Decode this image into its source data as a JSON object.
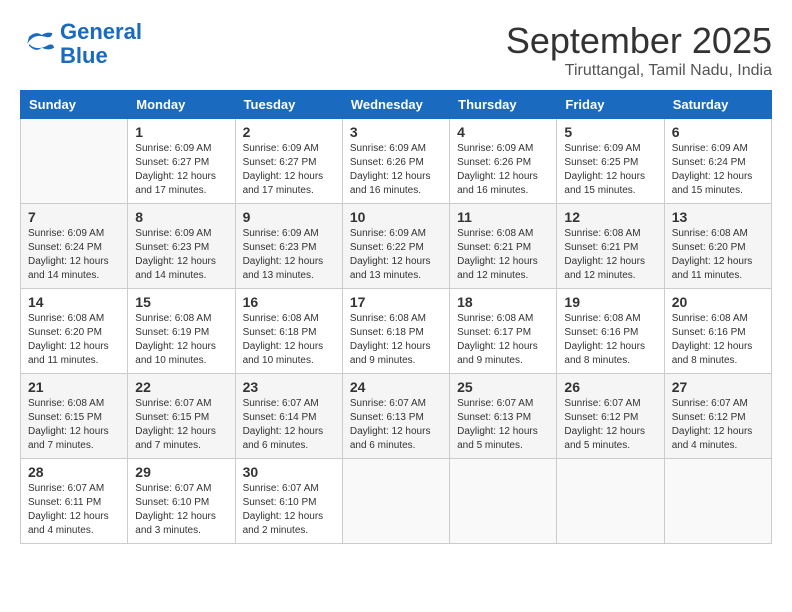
{
  "logo": {
    "line1": "General",
    "line2": "Blue"
  },
  "title": "September 2025",
  "location": "Tiruttangal, Tamil Nadu, India",
  "days_of_week": [
    "Sunday",
    "Monday",
    "Tuesday",
    "Wednesday",
    "Thursday",
    "Friday",
    "Saturday"
  ],
  "weeks": [
    [
      {
        "day": "",
        "info": ""
      },
      {
        "day": "1",
        "info": "Sunrise: 6:09 AM\nSunset: 6:27 PM\nDaylight: 12 hours\nand 17 minutes."
      },
      {
        "day": "2",
        "info": "Sunrise: 6:09 AM\nSunset: 6:27 PM\nDaylight: 12 hours\nand 17 minutes."
      },
      {
        "day": "3",
        "info": "Sunrise: 6:09 AM\nSunset: 6:26 PM\nDaylight: 12 hours\nand 16 minutes."
      },
      {
        "day": "4",
        "info": "Sunrise: 6:09 AM\nSunset: 6:26 PM\nDaylight: 12 hours\nand 16 minutes."
      },
      {
        "day": "5",
        "info": "Sunrise: 6:09 AM\nSunset: 6:25 PM\nDaylight: 12 hours\nand 15 minutes."
      },
      {
        "day": "6",
        "info": "Sunrise: 6:09 AM\nSunset: 6:24 PM\nDaylight: 12 hours\nand 15 minutes."
      }
    ],
    [
      {
        "day": "7",
        "info": "Sunrise: 6:09 AM\nSunset: 6:24 PM\nDaylight: 12 hours\nand 14 minutes."
      },
      {
        "day": "8",
        "info": "Sunrise: 6:09 AM\nSunset: 6:23 PM\nDaylight: 12 hours\nand 14 minutes."
      },
      {
        "day": "9",
        "info": "Sunrise: 6:09 AM\nSunset: 6:23 PM\nDaylight: 12 hours\nand 13 minutes."
      },
      {
        "day": "10",
        "info": "Sunrise: 6:09 AM\nSunset: 6:22 PM\nDaylight: 12 hours\nand 13 minutes."
      },
      {
        "day": "11",
        "info": "Sunrise: 6:08 AM\nSunset: 6:21 PM\nDaylight: 12 hours\nand 12 minutes."
      },
      {
        "day": "12",
        "info": "Sunrise: 6:08 AM\nSunset: 6:21 PM\nDaylight: 12 hours\nand 12 minutes."
      },
      {
        "day": "13",
        "info": "Sunrise: 6:08 AM\nSunset: 6:20 PM\nDaylight: 12 hours\nand 11 minutes."
      }
    ],
    [
      {
        "day": "14",
        "info": "Sunrise: 6:08 AM\nSunset: 6:20 PM\nDaylight: 12 hours\nand 11 minutes."
      },
      {
        "day": "15",
        "info": "Sunrise: 6:08 AM\nSunset: 6:19 PM\nDaylight: 12 hours\nand 10 minutes."
      },
      {
        "day": "16",
        "info": "Sunrise: 6:08 AM\nSunset: 6:18 PM\nDaylight: 12 hours\nand 10 minutes."
      },
      {
        "day": "17",
        "info": "Sunrise: 6:08 AM\nSunset: 6:18 PM\nDaylight: 12 hours\nand 9 minutes."
      },
      {
        "day": "18",
        "info": "Sunrise: 6:08 AM\nSunset: 6:17 PM\nDaylight: 12 hours\nand 9 minutes."
      },
      {
        "day": "19",
        "info": "Sunrise: 6:08 AM\nSunset: 6:16 PM\nDaylight: 12 hours\nand 8 minutes."
      },
      {
        "day": "20",
        "info": "Sunrise: 6:08 AM\nSunset: 6:16 PM\nDaylight: 12 hours\nand 8 minutes."
      }
    ],
    [
      {
        "day": "21",
        "info": "Sunrise: 6:08 AM\nSunset: 6:15 PM\nDaylight: 12 hours\nand 7 minutes."
      },
      {
        "day": "22",
        "info": "Sunrise: 6:07 AM\nSunset: 6:15 PM\nDaylight: 12 hours\nand 7 minutes."
      },
      {
        "day": "23",
        "info": "Sunrise: 6:07 AM\nSunset: 6:14 PM\nDaylight: 12 hours\nand 6 minutes."
      },
      {
        "day": "24",
        "info": "Sunrise: 6:07 AM\nSunset: 6:13 PM\nDaylight: 12 hours\nand 6 minutes."
      },
      {
        "day": "25",
        "info": "Sunrise: 6:07 AM\nSunset: 6:13 PM\nDaylight: 12 hours\nand 5 minutes."
      },
      {
        "day": "26",
        "info": "Sunrise: 6:07 AM\nSunset: 6:12 PM\nDaylight: 12 hours\nand 5 minutes."
      },
      {
        "day": "27",
        "info": "Sunrise: 6:07 AM\nSunset: 6:12 PM\nDaylight: 12 hours\nand 4 minutes."
      }
    ],
    [
      {
        "day": "28",
        "info": "Sunrise: 6:07 AM\nSunset: 6:11 PM\nDaylight: 12 hours\nand 4 minutes."
      },
      {
        "day": "29",
        "info": "Sunrise: 6:07 AM\nSunset: 6:10 PM\nDaylight: 12 hours\nand 3 minutes."
      },
      {
        "day": "30",
        "info": "Sunrise: 6:07 AM\nSunset: 6:10 PM\nDaylight: 12 hours\nand 2 minutes."
      },
      {
        "day": "",
        "info": ""
      },
      {
        "day": "",
        "info": ""
      },
      {
        "day": "",
        "info": ""
      },
      {
        "day": "",
        "info": ""
      }
    ]
  ]
}
